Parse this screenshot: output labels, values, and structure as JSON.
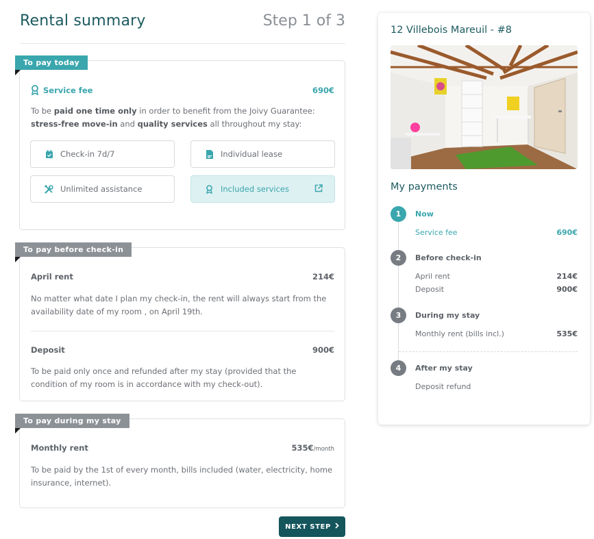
{
  "header": {
    "title": "Rental summary",
    "step": "Step 1 of 3"
  },
  "today": {
    "ribbon": "To pay today",
    "fee_label": "Service fee",
    "fee_amount": "690€",
    "desc_pre": "To be ",
    "desc_bold1": "paid one time only",
    "desc_mid": " in order to benefit from the Joivy Guarantee: ",
    "desc_bold2": "stress-free move-in",
    "desc_and": " and ",
    "desc_bold3": "quality services",
    "desc_post": " all throughout my stay:",
    "features": [
      {
        "label": "Check-in 7d/7",
        "icon": "calendar-check-icon"
      },
      {
        "label": "Individual lease",
        "icon": "document-icon"
      },
      {
        "label": "Unlimited assistance",
        "icon": "tools-icon"
      },
      {
        "label": "Included services",
        "icon": "award-icon"
      }
    ]
  },
  "before_checkin": {
    "ribbon": "To pay before check-in",
    "rent_label": "April rent",
    "rent_amount": "214€",
    "rent_desc": "No matter what date I plan my check-in, the rent will always start from the availability date of my room , on April 19th.",
    "deposit_label": "Deposit",
    "deposit_amount": "900€",
    "deposit_desc": "To be paid only once and refunded after my stay (provided that the condition of my room is in accordance with my check-out)."
  },
  "during_stay": {
    "ribbon": "To pay during my stay",
    "label": "Monthly rent",
    "amount": "535€",
    "per": "/month",
    "desc": "To be paid by the 1st of every month, bills included (water, electricity, home insurance, internet)."
  },
  "next_button": "NEXT STEP",
  "panel": {
    "title": "12 Villebois Mareuil - #8",
    "payments_title": "My payments",
    "stages": [
      {
        "num": "1",
        "label": "Now",
        "lines": [
          {
            "label": "Service fee",
            "amount": "690€"
          }
        ]
      },
      {
        "num": "2",
        "label": "Before check-in",
        "lines": [
          {
            "label": "April rent",
            "amount": "214€"
          },
          {
            "label": "Deposit",
            "amount": "900€"
          }
        ]
      },
      {
        "num": "3",
        "label": "During my stay",
        "lines": [
          {
            "label": "Monthly rent (bills incl.)",
            "amount": "535€"
          }
        ]
      },
      {
        "num": "4",
        "label": "After my stay",
        "lines": [
          {
            "label": "Deposit refund",
            "amount": ""
          }
        ]
      }
    ]
  },
  "colors": {
    "teal": "#3aa6ad",
    "dark_teal": "#15555c",
    "grey_badge": "#8c9196"
  }
}
